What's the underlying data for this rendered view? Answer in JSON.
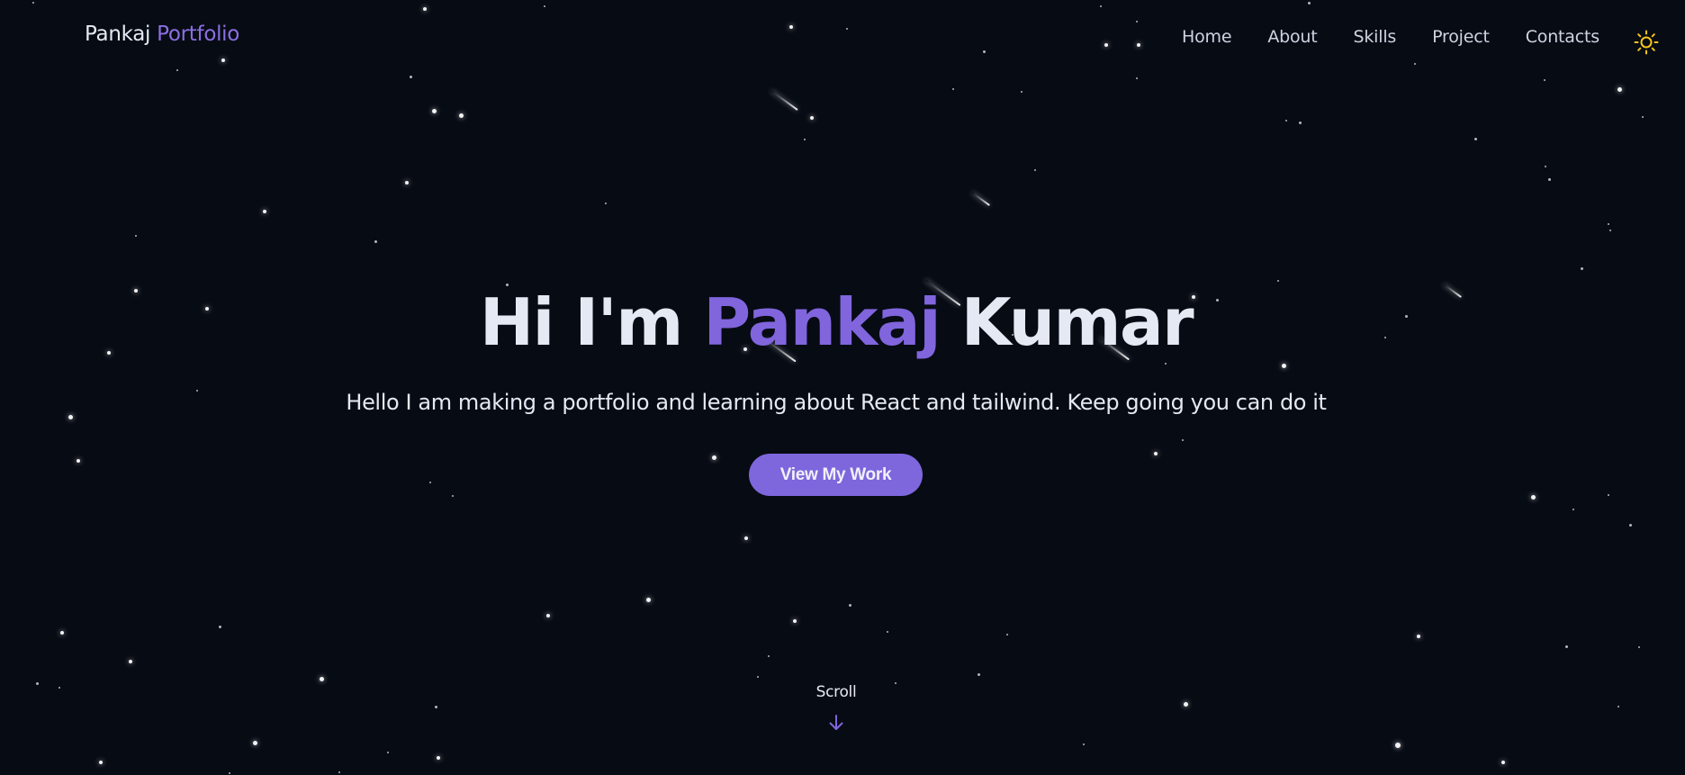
{
  "header": {
    "logo_first": "Pankaj",
    "logo_second": "Portfolio",
    "nav": [
      {
        "label": "Home"
      },
      {
        "label": "About"
      },
      {
        "label": "Skills"
      },
      {
        "label": "Project"
      },
      {
        "label": "Contacts"
      }
    ],
    "theme_icon": "sun-icon"
  },
  "hero": {
    "greeting": "Hi I'm",
    "first_name": "Pankaj",
    "last_name": "Kumar",
    "subtitle": "Hello I am making a portfolio and learning about React and tailwind. Keep going you can do it",
    "cta_label": "View My Work"
  },
  "scroll": {
    "label": "Scroll",
    "icon": "arrow-down-icon"
  },
  "colors": {
    "background": "#070b14",
    "accent": "#8065dd",
    "text": "#e5e9f3",
    "theme_icon": "#f5c518"
  }
}
